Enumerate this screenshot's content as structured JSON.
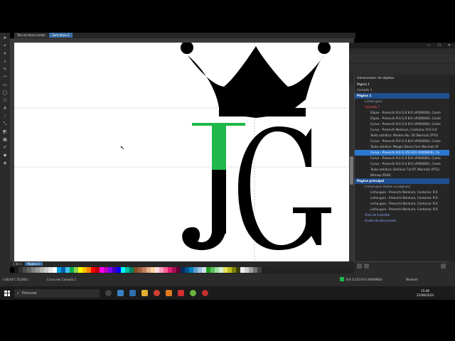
{
  "app": {
    "window_title": "CorelDRAW X8 (64 Bit) - Sem título-1",
    "window_controls": [
      "—",
      "☐",
      "✕"
    ]
  },
  "menu": [
    "Arquivo",
    "Editar",
    "Exibir",
    "Layout",
    "Objeto",
    "Efeitos",
    "Bitmaps",
    "Texto",
    "Tabela",
    "Ferramentas",
    "Janela",
    "Ajuda"
  ],
  "toolbar": {
    "zoom_value": "300%",
    "snap_label": "Alinhar a"
  },
  "tabs": [
    {
      "label": "Tela de boas-vindas",
      "active": false
    },
    {
      "label": "Sem título-1",
      "active": true
    }
  ],
  "page_nav": {
    "counter": "1 de 1",
    "page_tab": "Página 1"
  },
  "status": {
    "coords": "(-48,927; 50,000 )",
    "object_info": "Curva em Camada 1",
    "fill_info": "R:0 G:153 B:0 (#009900)",
    "outline_info": "Nenhum"
  },
  "docker": {
    "title": "Gerenciador de objetos",
    "current_page": "Página 1",
    "current_layer": "Camada 1",
    "rows": [
      {
        "text": "Página 1",
        "kind": "page"
      },
      {
        "text": "Linhas-guia",
        "kind": "guide"
      },
      {
        "text": "Camada 1",
        "kind": "layer"
      },
      {
        "text": "Elipse - Preenchi R:0 G:0 B:0 (#000000), Conto",
        "kind": "obj"
      },
      {
        "text": "Elipse - Preenchi R:0 G:0 B:0 (#000000), Conto",
        "kind": "obj"
      },
      {
        "text": "Curva - Preenchi R:0 G:0 B:0 (#000000), Conto",
        "kind": "obj"
      },
      {
        "text": "Curva - Preenchi Nenhum, Contorno: R:0 G:0",
        "kind": "obj"
      },
      {
        "text": "Texto artístico: Modern No. 20 (Normal) (PTG)",
        "kind": "obj"
      },
      {
        "text": "Curva - Preenchi R:0 G:0 B:0 (#000000), Conto",
        "kind": "obj"
      },
      {
        "text": "Texto artístico: Megan Demo Font (Normal) (P",
        "kind": "obj"
      },
      {
        "text": "Curva - Preenchi R:0 G:153 B:0 (#009900), Co",
        "kind": "sel"
      },
      {
        "text": "Curva - Preenchi R:0 G:0 B:0 (#000000), Conto",
        "kind": "obj"
      },
      {
        "text": "Curva - Preenchi R:0 G:0 B:0 (#000000), Conto",
        "kind": "obj"
      },
      {
        "text": "Texto artístico: DeVinne Txt BT (Normal) (PTG)",
        "kind": "obj"
      },
      {
        "text": "Bitmap (RGB)",
        "kind": "obj"
      },
      {
        "text": "Página principal",
        "kind": "page"
      },
      {
        "text": "Linhas-guia (todas as páginas)",
        "kind": "guide"
      },
      {
        "text": "Linha-guia - Preenchi Nenhum, Contorno: R:0",
        "kind": "obj"
      },
      {
        "text": "Linha-guia - Preenchi Nenhum, Contorno: R:0",
        "kind": "obj"
      },
      {
        "text": "Linha-guia - Preenchi Nenhum, Contorno: R:0",
        "kind": "obj"
      },
      {
        "text": "Linha-guia - Preenchi Nenhum, Contorno: R:0",
        "kind": "obj"
      },
      {
        "text": "Área de trabalho",
        "kind": "master"
      },
      {
        "text": "Grade de documento",
        "kind": "master"
      }
    ]
  },
  "taskbar": {
    "search_placeholder": "Procurar",
    "time": "15:48",
    "date": "25/08/2024"
  },
  "canvas_art": {
    "letters": "JG",
    "fill_green": "#1fb84a",
    "fill_black": "#000000"
  },
  "palette": [
    "#000000",
    "#1a1a1a",
    "#333333",
    "#4d4d4d",
    "#666666",
    "#808080",
    "#999999",
    "#b3b3b3",
    "#cccccc",
    "#e6e6e6",
    "#ffffff",
    "#00a0e0",
    "#0060b0",
    "#40c0f0",
    "#00b050",
    "#90d050",
    "#ffff00",
    "#ffc000",
    "#ff8000",
    "#ff0000",
    "#c00000",
    "#ff00ff",
    "#c000c0",
    "#8000ff",
    "#4000c0",
    "#0000ff",
    "#00ffff",
    "#00c0a0",
    "#008060",
    "#805020",
    "#a06040",
    "#c08060",
    "#e0b090",
    "#ffd0a0",
    "#ffe0e0",
    "#ffa0c0",
    "#ff6090",
    "#e02070",
    "#a01050",
    "#600030",
    "#003060",
    "#005090",
    "#0080c0",
    "#60a0d0",
    "#a0c0e0",
    "#d0e0f0",
    "#20a020",
    "#60c060",
    "#a0e0a0",
    "#d0f0d0",
    "#e0e060",
    "#c0c020",
    "#808010",
    "#404008",
    "#f0f0f0",
    "#d0d0d0",
    "#a0a0a0",
    "#707070",
    "#404040",
    "#202020"
  ]
}
